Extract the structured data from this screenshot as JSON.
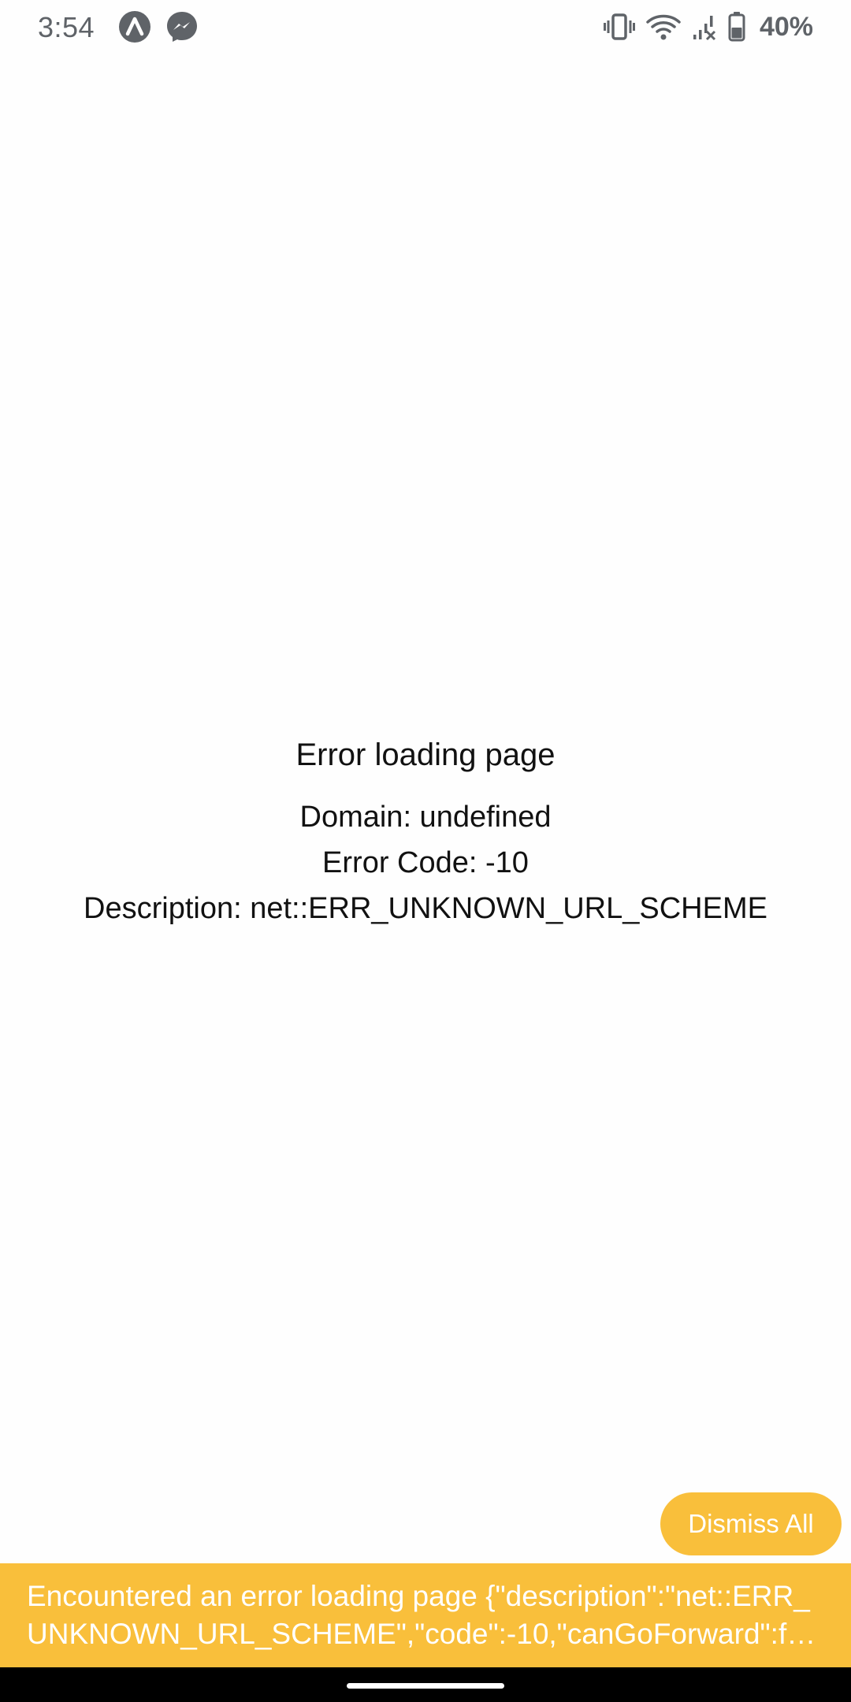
{
  "status_bar": {
    "time": "3:54",
    "battery_percent": "40%",
    "left_icons": [
      "arc-app-icon",
      "messenger-icon"
    ],
    "right_icons": [
      "vibrate-icon",
      "wifi-icon",
      "cell-signal-icon",
      "battery-icon"
    ]
  },
  "error_page": {
    "title": "Error loading page",
    "domain_line": "Domain: undefined",
    "code_line": "Error Code: -10",
    "description_line": "Description: net::ERR_UNKNOWN_URL_SCHEME"
  },
  "toast": {
    "dismiss_label": "Dismiss All",
    "message": "Encountered an error loading page {\"description\":\"net::ERR_UNKNOWN_URL_SCHEME\",\"code\":-10,\"canGoForward\":f…"
  },
  "colors": {
    "toast_bg": "#f9bf3b",
    "toast_text": "#ffffff",
    "status_icon": "#5f6368",
    "error_text": "#111111"
  }
}
